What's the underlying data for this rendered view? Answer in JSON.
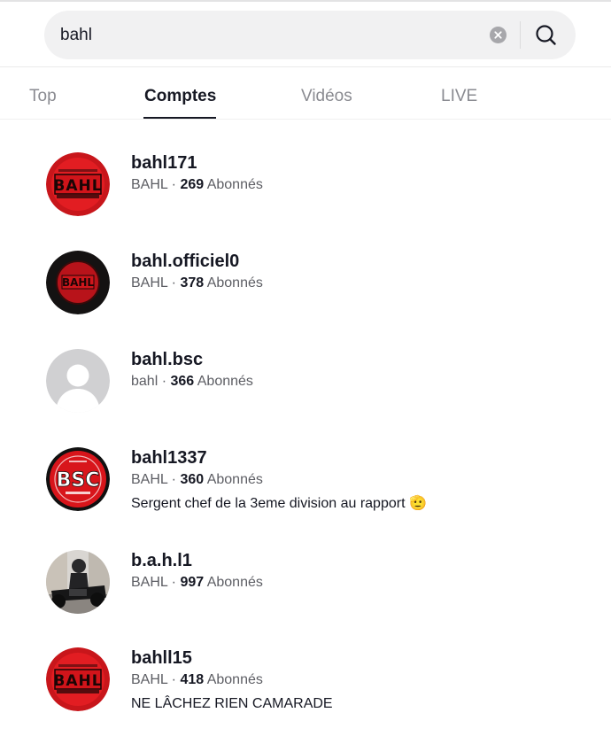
{
  "search": {
    "query": "bahl",
    "clear_icon": "clear-icon",
    "search_icon": "search-icon"
  },
  "tabs": [
    {
      "label": "Top",
      "active": false
    },
    {
      "label": "Comptes",
      "active": true
    },
    {
      "label": "Vidéos",
      "active": false
    },
    {
      "label": "LIVE",
      "active": false
    }
  ],
  "accounts": [
    {
      "username": "bahl171",
      "nickname": "BAHL",
      "separator": "·",
      "followers": "269",
      "followers_label": "Abonnés",
      "bio": "",
      "avatar": "bahl-red-logo"
    },
    {
      "username": "bahl.officiel0",
      "nickname": "BAHL",
      "separator": "·",
      "followers": "378",
      "followers_label": "Abonnés",
      "bio": "",
      "avatar": "bahl-dark-logo"
    },
    {
      "username": "bahl.bsc",
      "nickname": "bahl",
      "separator": "·",
      "followers": "366",
      "followers_label": "Abonnés",
      "bio": "",
      "avatar": "default-avatar"
    },
    {
      "username": "bahl1337",
      "nickname": "BAHL",
      "separator": "·",
      "followers": "360",
      "followers_label": "Abonnés",
      "bio": "Sergent chef de la 3eme division au rapport 🫡",
      "avatar": "bsc-logo"
    },
    {
      "username": "b.a.h.l1",
      "nickname": "BAHL",
      "separator": "·",
      "followers": "997",
      "followers_label": "Abonnés",
      "bio": "",
      "avatar": "motorcycle-photo"
    },
    {
      "username": "bahll15",
      "nickname": "BAHL",
      "separator": "·",
      "followers": "418",
      "followers_label": "Abonnés",
      "bio": "NE LÂCHEZ RIEN CAMARADE",
      "avatar": "bahl-red-logo"
    }
  ],
  "colors": {
    "text_primary": "#161823",
    "text_secondary": "#5c5d63",
    "tab_inactive": "#8a8b91",
    "search_bg": "#f1f1f2",
    "logo_red": "#d9141a"
  }
}
